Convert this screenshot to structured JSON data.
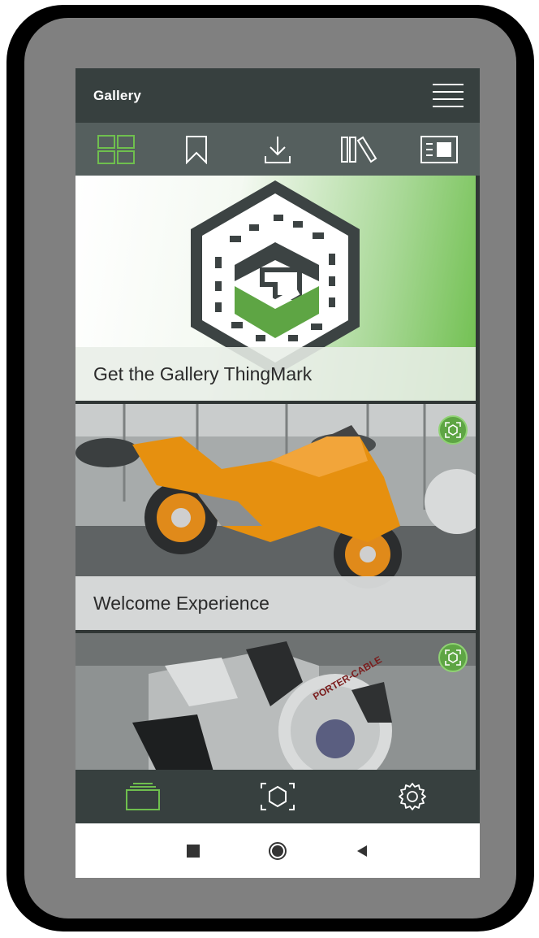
{
  "header": {
    "title": "Gallery"
  },
  "tabs": [
    {
      "icon": "grid-icon",
      "active": true
    },
    {
      "icon": "bookmark-icon",
      "active": false
    },
    {
      "icon": "download-icon",
      "active": false
    },
    {
      "icon": "library-icon",
      "active": false
    },
    {
      "icon": "info-card-icon",
      "active": false
    }
  ],
  "cards": [
    {
      "title": "Get the Gallery ThingMark",
      "image": "thingmark-logo"
    },
    {
      "title": "Welcome Experience",
      "image": "orange-motorcycle",
      "badge": "ar-scan-icon"
    },
    {
      "title": "",
      "image": "circular-saw",
      "badge": "ar-scan-icon"
    }
  ],
  "bottom_nav": [
    {
      "icon": "experiences-icon",
      "active": true
    },
    {
      "icon": "scan-icon",
      "active": false
    },
    {
      "icon": "settings-icon",
      "active": false
    }
  ],
  "system_nav": [
    "recents-icon",
    "home-icon",
    "back-icon"
  ],
  "colors": {
    "accent": "#6fbf4e",
    "header": "#37403f",
    "tabbar": "#555f5e"
  }
}
